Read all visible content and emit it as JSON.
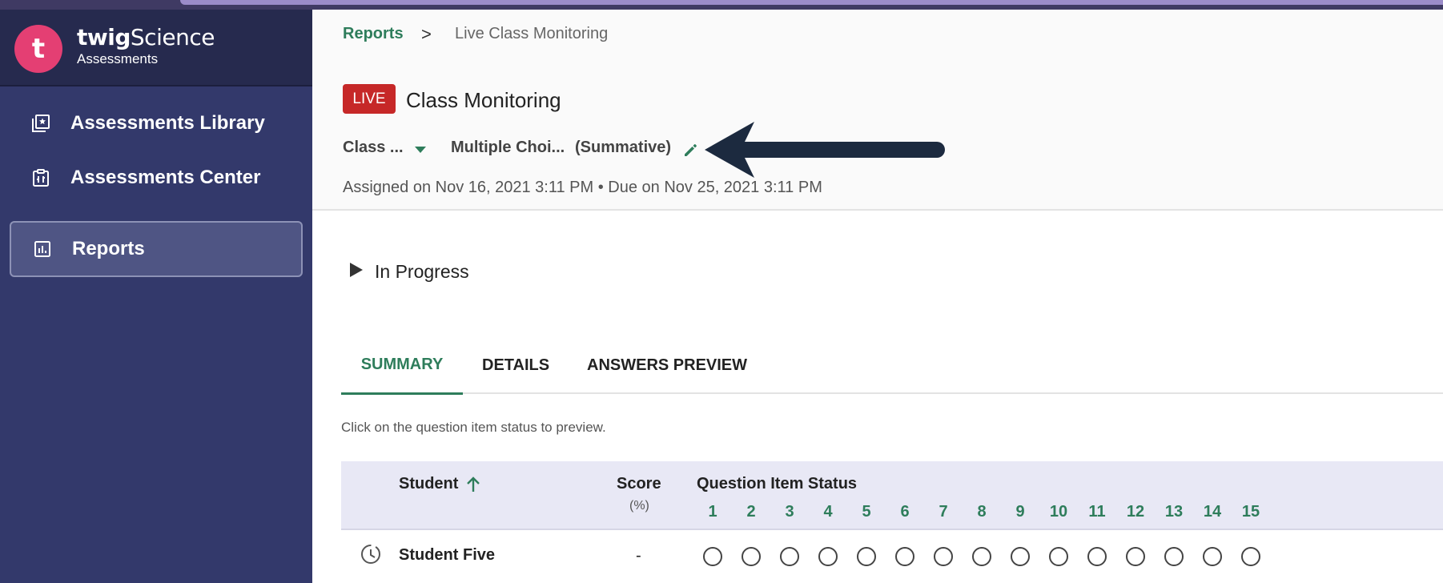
{
  "brand": {
    "name_prefix": "twig",
    "name_suffix": "Science",
    "subtitle": "Assessments",
    "logo_letter": "t",
    "logo_color": "#e43f73"
  },
  "sidebar": {
    "items": [
      {
        "label": "Assessments Library",
        "icon": "library-icon"
      },
      {
        "label": "Assessments Center",
        "icon": "clipboard-icon"
      },
      {
        "label": "Reports",
        "icon": "chart-icon",
        "active": true
      }
    ]
  },
  "breadcrumb": {
    "link": "Reports",
    "separator": ">",
    "current": "Live Class Monitoring"
  },
  "header": {
    "live_badge": "LIVE",
    "title": "Class Monitoring",
    "class_select": "Class ...",
    "assessment_name": "Multiple Choi...",
    "assessment_type": "(Summative)",
    "assigned": "Assigned on Nov 16, 2021 3:11 PM  •  Due on Nov 25, 2021 3:11 PM"
  },
  "progress": {
    "label": "In Progress"
  },
  "tabs": [
    {
      "label": "SUMMARY",
      "active": true
    },
    {
      "label": "DETAILS"
    },
    {
      "label": "ANSWERS PREVIEW"
    }
  ],
  "hint": "Click on the question item status to preview.",
  "table": {
    "student_header": "Student",
    "score_header": "Score",
    "score_unit": "(%)",
    "status_header": "Question Item Status",
    "question_numbers": [
      "1",
      "2",
      "3",
      "4",
      "5",
      "6",
      "7",
      "8",
      "9",
      "10",
      "11",
      "12",
      "13",
      "14",
      "15"
    ],
    "rows": [
      {
        "name": "Student Five",
        "score": "-"
      }
    ]
  },
  "colors": {
    "sidebar_bg": "#33396b",
    "accent_green": "#2e7d5b",
    "live_red": "#c62828"
  }
}
